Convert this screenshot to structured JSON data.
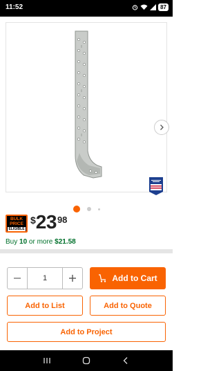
{
  "status_bar": {
    "time": "11:52",
    "battery": "87"
  },
  "gallery": {
    "image": "metal-hanger-strap",
    "badge": "made-in-usa",
    "active_slide": 1,
    "slide_count": 3
  },
  "pricing": {
    "bulk_badge": {
      "line1": "BULK",
      "line2": "PRICE",
      "line3": "ELIGIBLE"
    },
    "currency_symbol": "$",
    "dollars": "23",
    "cents": "98",
    "bulk_offer": {
      "prefix": "Buy ",
      "quantity": "10",
      "middle": " or more ",
      "price": "$21.58"
    }
  },
  "quantity": {
    "value": "1",
    "decrement_icon": "minus-icon",
    "increment_icon": "plus-icon"
  },
  "actions": {
    "add_to_cart": "Add to Cart",
    "add_to_list": "Add to List",
    "add_to_quote": "Add to Quote",
    "add_to_project": "Add to Project"
  },
  "colors": {
    "brand_orange": "#f96302",
    "offer_green": "#00702b"
  }
}
